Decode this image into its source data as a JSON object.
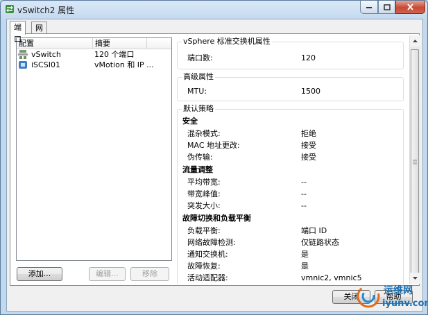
{
  "window": {
    "title": "vSwitch2 属性"
  },
  "tabs": [
    {
      "label": "端口"
    },
    {
      "label": "网络适配器"
    }
  ],
  "list": {
    "headers": {
      "config": "配置",
      "summary": "摘要"
    },
    "rows": [
      {
        "name": "vSwitch",
        "summary": "120 个端口",
        "icon": "vswitch-icon"
      },
      {
        "name": "iSCSI01",
        "summary": "vMotion 和 IP ...",
        "icon": "vmkernel-port-icon"
      }
    ]
  },
  "buttons": {
    "add": "添加...",
    "edit": "编辑...",
    "remove": "移除",
    "close": "关闭",
    "help": "帮助"
  },
  "details": {
    "vswitch_props": {
      "title": "vSphere 标准交换机属性",
      "ports_label": "端口数:",
      "ports_value": "120"
    },
    "advanced": {
      "title": "高级属性",
      "mtu_label": "MTU:",
      "mtu_value": "1500"
    },
    "policy": {
      "title": "默认策略",
      "security": {
        "heading": "安全",
        "items": [
          {
            "label": "混杂模式:",
            "value": "拒绝"
          },
          {
            "label": "MAC 地址更改:",
            "value": "接受"
          },
          {
            "label": "伪传输:",
            "value": "接受"
          }
        ]
      },
      "traffic": {
        "heading": "流量调整",
        "items": [
          {
            "label": "平均带宽:",
            "value": "--"
          },
          {
            "label": "带宽峰值:",
            "value": "--"
          },
          {
            "label": "突发大小:",
            "value": "--"
          }
        ]
      },
      "failover": {
        "heading": "故障切换和负载平衡",
        "items": [
          {
            "label": "负载平衡:",
            "value": "端口 ID"
          },
          {
            "label": "网络故障检测:",
            "value": "仅链路状态"
          },
          {
            "label": "通知交换机:",
            "value": "是"
          },
          {
            "label": "故障恢复:",
            "value": "是"
          },
          {
            "label": "活动适配器:",
            "value": "vmnic2, vmnic5"
          }
        ]
      }
    }
  },
  "watermark": {
    "text": "运维网",
    "url": "iyunv.com"
  }
}
